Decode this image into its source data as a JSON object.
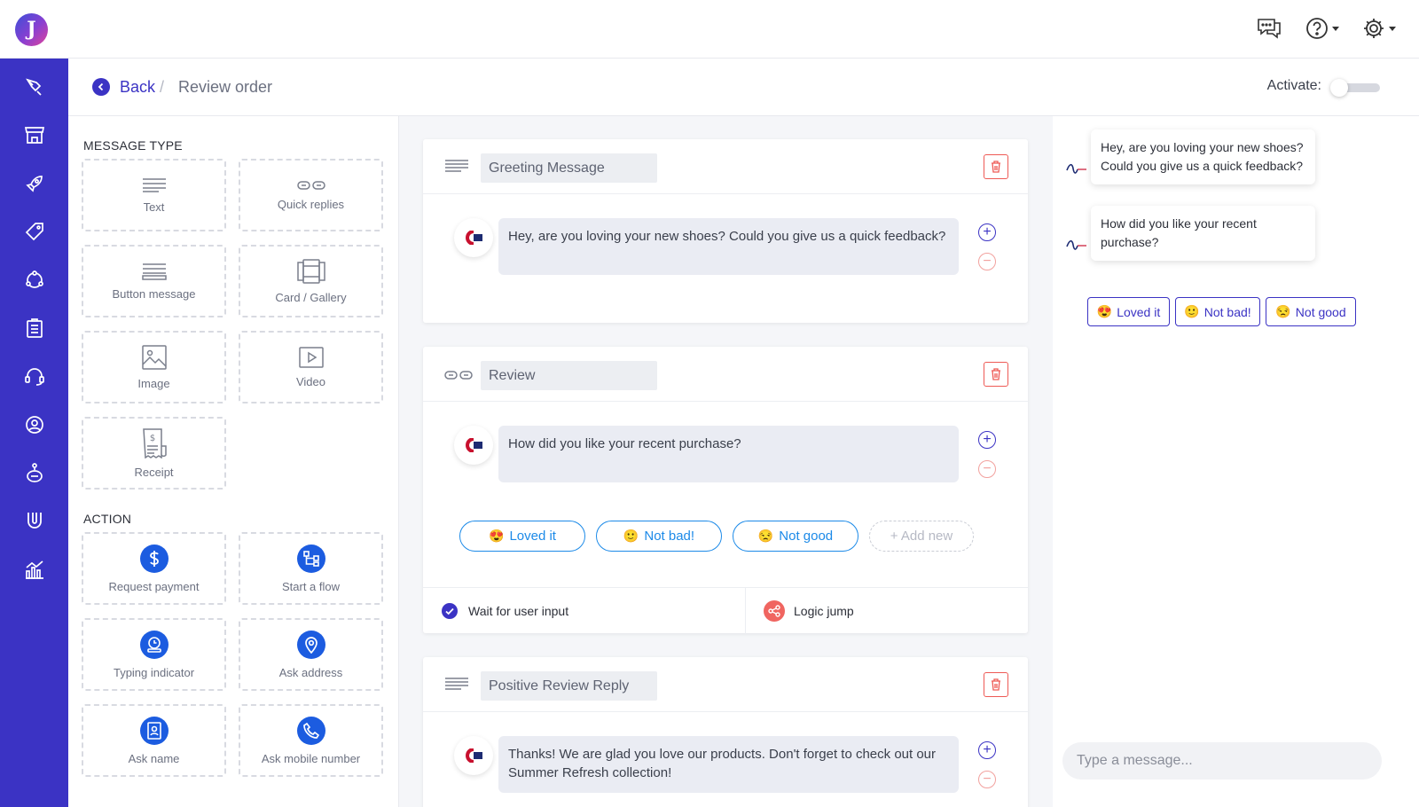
{
  "app": {
    "logo_letter": "J"
  },
  "header": {
    "icons": [
      "chat-icon",
      "help-icon",
      "settings-icon"
    ]
  },
  "sidebar": {
    "toggle_glyph": "»",
    "items": [
      "pen-tool-icon",
      "store-icon",
      "rocket-icon",
      "tag-icon",
      "integrations-icon",
      "clipboard-icon",
      "headset-icon",
      "user-circle-icon",
      "bot-icon",
      "magnet-icon",
      "analytics-icon"
    ]
  },
  "breadcrumb": {
    "back_label": "Back",
    "separator": "/",
    "current": "Review order"
  },
  "activate": {
    "label": "Activate:",
    "enabled": false
  },
  "palette": {
    "message_type_title": "MESSAGE TYPE",
    "message_types": [
      {
        "label": "Text",
        "icon": "text-lines-icon"
      },
      {
        "label": "Quick replies",
        "icon": "quick-replies-icon"
      },
      {
        "label": "Button message",
        "icon": "button-message-icon"
      },
      {
        "label": "Card / Gallery",
        "icon": "card-gallery-icon"
      },
      {
        "label": "Image",
        "icon": "image-icon"
      },
      {
        "label": "Video",
        "icon": "video-icon"
      },
      {
        "label": "Receipt",
        "icon": "receipt-icon"
      }
    ],
    "action_title": "ACTION",
    "actions": [
      {
        "label": "Request payment",
        "icon": "dollar-icon"
      },
      {
        "label": "Start a flow",
        "icon": "flow-icon"
      },
      {
        "label": "Typing indicator",
        "icon": "typing-icon"
      },
      {
        "label": "Ask address",
        "icon": "location-icon"
      },
      {
        "label": "Ask name",
        "icon": "badge-icon"
      },
      {
        "label": "Ask mobile number",
        "icon": "phone-icon"
      }
    ]
  },
  "flow": {
    "cards": [
      {
        "title": "Greeting Message",
        "message": "Hey, are you loving your new shoes? Could you give us a quick feedback?"
      },
      {
        "title": "Review",
        "message": "How did you like your recent purchase?",
        "quick_replies": [
          {
            "emoji": "😍",
            "label": "Loved it"
          },
          {
            "emoji": "🙂",
            "label": "Not bad!"
          },
          {
            "emoji": "😒",
            "label": "Not good"
          }
        ],
        "add_new_label": "+ Add new",
        "wait_label": "Wait for user input",
        "wait_checked": true,
        "logic_jump_label": "Logic jump"
      },
      {
        "title": "Positive Review Reply",
        "message": "Thanks! We are glad you love our products. Don't forget to check out our Summer Refresh collection!"
      }
    ]
  },
  "preview": {
    "messages": [
      "Hey, are you loving your new shoes? Could you give us a quick feedback?",
      "How did you like your recent purchase?"
    ],
    "quick_replies": [
      {
        "emoji": "😍",
        "label": "Loved it"
      },
      {
        "emoji": "🙂",
        "label": "Not bad!"
      },
      {
        "emoji": "😒",
        "label": "Not good"
      }
    ],
    "input_placeholder": "Type a message..."
  },
  "colors": {
    "brand": "#3b33c4",
    "action_blue": "#1c5ce0",
    "quick_reply_blue": "#1c8ae8",
    "danger": "#ee5a55"
  }
}
